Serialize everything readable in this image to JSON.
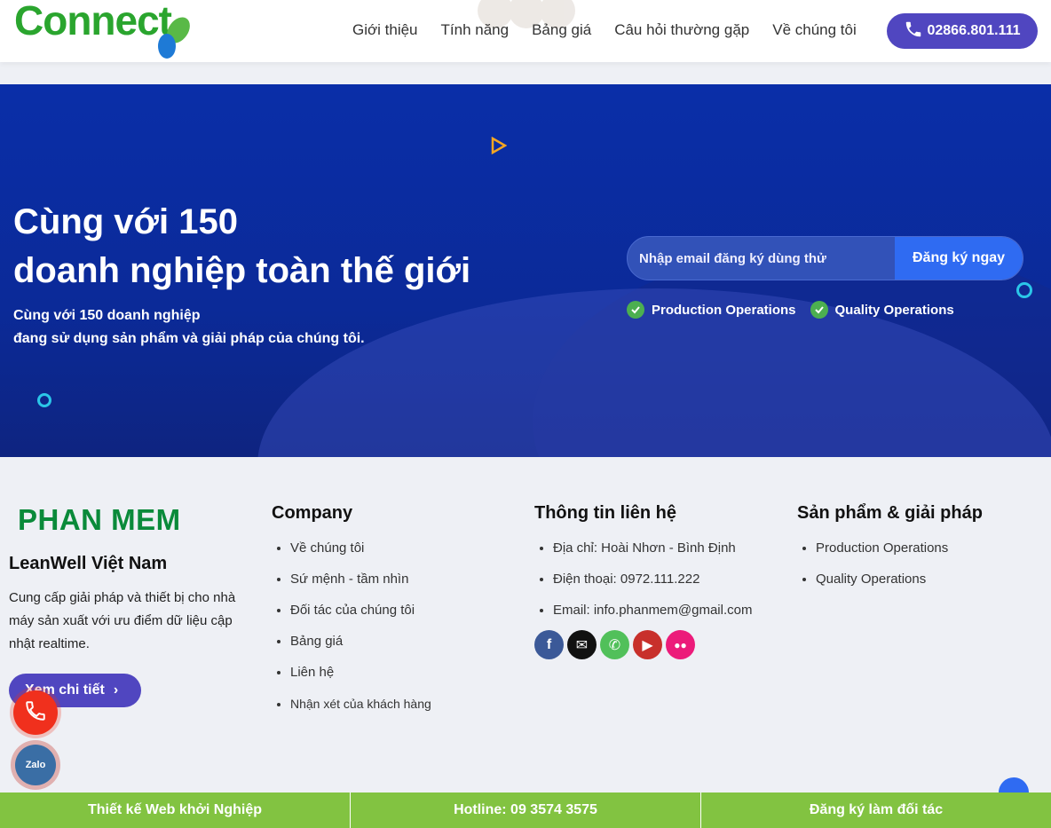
{
  "header": {
    "logo_text": "Connect",
    "nav": [
      "Giới thiệu",
      "Tính năng",
      "Bảng giá",
      "Câu hỏi thường gặp",
      "Về chúng tôi"
    ],
    "phone": "02866.801.111"
  },
  "hero": {
    "title_line1": "Cùng với 150",
    "title_line2": "doanh nghiệp toàn thế giới",
    "sub_line1": "Cùng với 150 doanh nghiệp",
    "sub_line2": "đang sử dụng sản phẩm và giải pháp của chúng tôi.",
    "email_placeholder": "Nhập email đăng ký dùng thử",
    "signup_button": "Đăng ký ngay",
    "checks": [
      "Production Operations",
      "Quality Operations"
    ]
  },
  "footer": {
    "brand": "PHAN MEM",
    "company_name": "LeanWell Việt Nam",
    "company_desc": "Cung cấp giải pháp và thiết bị cho nhà máy sản xuất với ưu điểm dữ liệu cập nhật realtime.",
    "more_button": "Xem chi tiết",
    "company": {
      "title": "Company",
      "items": [
        "Về chúng tôi",
        "Sứ mệnh - tầm nhìn",
        "Đối tác của chúng tôi",
        "Bảng giá",
        "Liên hệ",
        "Nhận xét của khách hàng"
      ]
    },
    "contact": {
      "title": "Thông tin liên hệ",
      "items": [
        "Địa chỉ: Hoài Nhơn - Bình Định",
        "Điện thoại: 0972.111.222",
        "Email: info.phanmem@gmail.com"
      ]
    },
    "products": {
      "title": "Sản phẩm & giải pháp",
      "items": [
        "Production Operations",
        "Quality Operations"
      ]
    },
    "socials": [
      "facebook-icon",
      "email-icon",
      "phone-icon",
      "youtube-icon",
      "flickr-icon"
    ]
  },
  "floating": {
    "zalo_label": "Zalo"
  },
  "bottom_bar": [
    "Thiết kế Web khởi Nghiệp",
    "Hotline: 09 3574 3575",
    "Đăng ký làm đối tác"
  ],
  "colors": {
    "brand_green": "#2aa52e",
    "primary_purple": "#5046c0",
    "hero_blue": "#0a2ea8",
    "bottom_green": "#82c341"
  }
}
